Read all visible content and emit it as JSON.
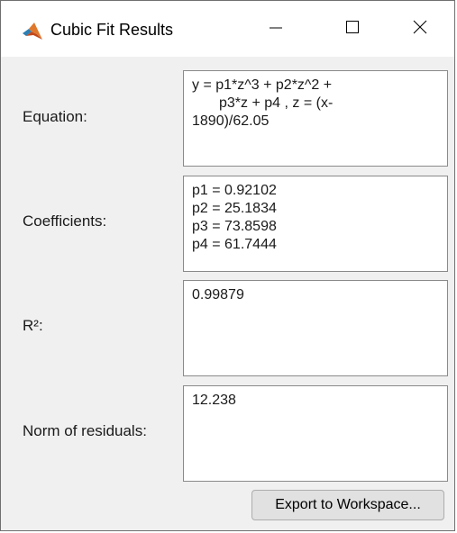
{
  "window": {
    "title": "Cubic Fit Results",
    "app_icon": "matlab-membrane-icon"
  },
  "controls": {
    "minimize_icon": "minimize-icon",
    "maximize_icon": "maximize-icon",
    "close_icon": "close-icon"
  },
  "equation": {
    "label": "Equation:",
    "lines": [
      "y = p1*z^3 + p2*z^2 +",
      "p3*z + p4 , z = (x-",
      "1890)/62.05"
    ]
  },
  "coefficients": {
    "label": "Coefficients:",
    "lines": [
      "p1 = 0.92102",
      "p2 = 25.1834",
      "p3 = 73.8598",
      "p4 = 61.7444"
    ]
  },
  "r_squared": {
    "label": "R²:",
    "value": "0.99879"
  },
  "norm_residuals": {
    "label": "Norm of residuals:",
    "value": "12.238"
  },
  "export_button": {
    "label": "Export to Workspace..."
  },
  "colors": {
    "window_bg": "#f0f0f0",
    "titlebar_bg": "#ffffff",
    "field_bg": "#ffffff",
    "field_border": "#8a8a8a",
    "button_bg": "#e1e1e1"
  }
}
